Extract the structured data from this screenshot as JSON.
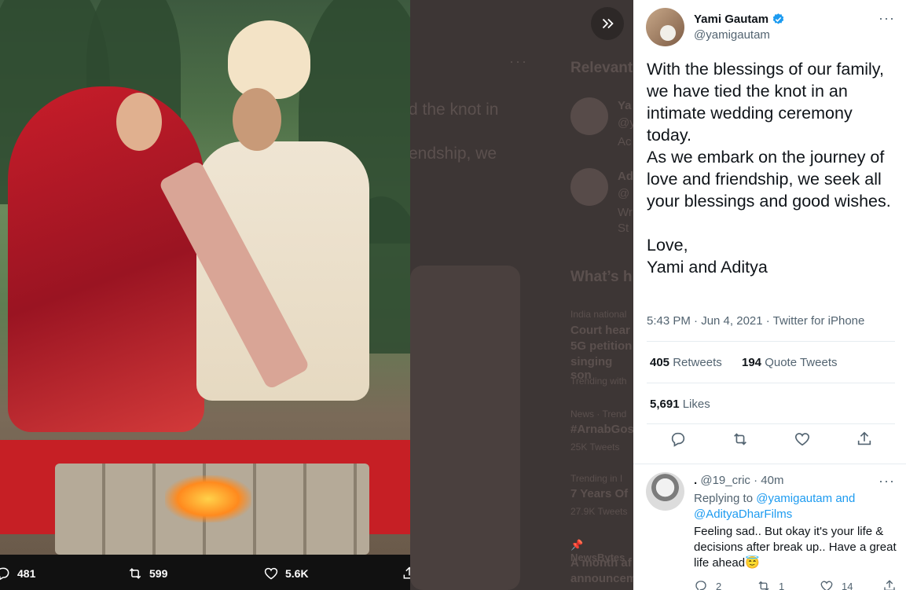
{
  "media": {
    "alt": "Wedding photo",
    "bar": {
      "replies": "481",
      "retweets": "599",
      "likes": "5.6K"
    }
  },
  "background_timeline": {
    "section_relevant": "Relevant",
    "section_whats": "What’s h",
    "partial_text_1": "d the knot in",
    "partial_text_2": "endship, we",
    "trend_1_context": "India national",
    "trend_1_title": "Court hear",
    "trend_1_line2": "5G petition",
    "trend_1_line3": "singing son",
    "trend_1_meta": "Trending with",
    "trend_2_context": "News · Trend",
    "trend_2_title": "#ArnabGos",
    "trend_2_meta": "25K Tweets",
    "trend_3_context": "Trending in I",
    "trend_3_title": "7 Years Of",
    "trend_3_meta": "27.9K Tweets",
    "trend_4_context": "NewsBytes",
    "trend_4_title": "A month af",
    "trend_4_line2": "announcem",
    "relevant_1_name": "Ya",
    "relevant_1_handle": "@y",
    "relevant_1_bio": "Ac",
    "relevant_2_name": "Ad",
    "relevant_2_handle": "@",
    "relevant_2_bio_1": "Wr",
    "relevant_2_bio_2": "St"
  },
  "tweet": {
    "author_name": "Yami Gautam",
    "author_handle": "@yamigautam",
    "text": "With the blessings of our family, we have tied the knot in an intimate wedding ceremony today.\nAs we embark on the journey of love and friendship, we seek all your blessings and good wishes.\n\nLove,\nYami and Aditya",
    "timestamp": "5:43 PM · Jun 4, 2021 · Twitter for iPhone",
    "retweets_count": "405",
    "retweets_label": "Retweets",
    "quotes_count": "194",
    "quotes_label": "Quote Tweets",
    "likes_count": "5,691",
    "likes_label": "Likes"
  },
  "reply": {
    "name": ".",
    "handle": "@19_cric",
    "time": "40m",
    "replying_prefix": "Replying to",
    "replying_to_1": "@yamigautam",
    "replying_and": "and",
    "replying_to_2": "@AdityaDharFilms",
    "text": "Feeling sad.. But okay it's your life & decisions after break up.. Have a great life ahead😇",
    "replies": "2",
    "retweets": "1",
    "likes": "14"
  },
  "colors": {
    "accent": "#1d9bf0",
    "text_primary": "#0f1419",
    "text_secondary": "#536471"
  }
}
